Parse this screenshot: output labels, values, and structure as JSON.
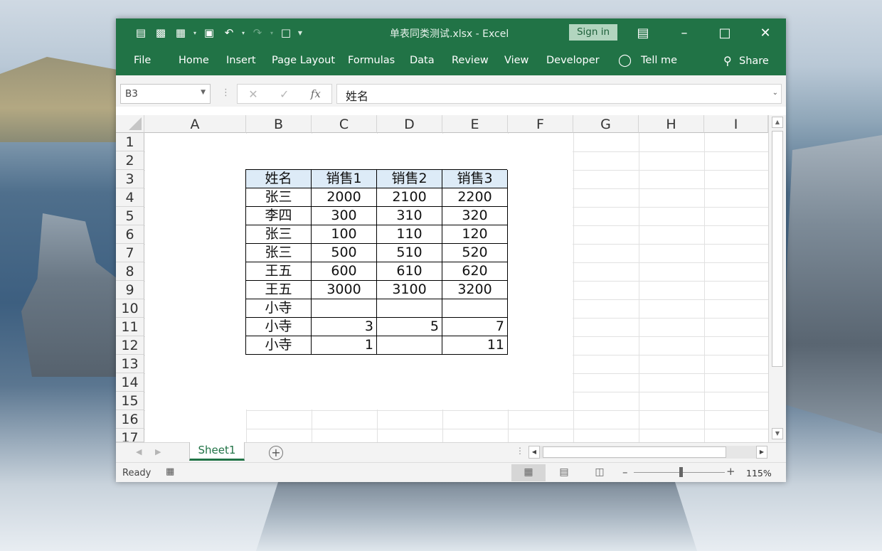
{
  "window": {
    "title": "单表同类测试.xlsx  -  Excel",
    "signin_label": "Sign in",
    "accent_color": "#217346"
  },
  "quick_access": {
    "icons": [
      "form-icon",
      "save-as-icon",
      "layout-icon",
      "save-icon",
      "undo-icon",
      "redo-icon",
      "new-doc-icon",
      "customize-icon"
    ]
  },
  "ribbon": {
    "tabs": [
      "File",
      "Home",
      "Insert",
      "Page Layout",
      "Formulas",
      "Data",
      "Review",
      "View",
      "Developer"
    ],
    "tell_me": "Tell me",
    "share": "Share"
  },
  "formula_bar": {
    "name_box": "B3",
    "content": "姓名",
    "fx_label": "fx"
  },
  "grid": {
    "columns": [
      "A",
      "B",
      "C",
      "D",
      "E",
      "F",
      "G",
      "H",
      "I"
    ],
    "rows": [
      "1",
      "2",
      "3",
      "4",
      "5",
      "6",
      "7",
      "8",
      "9",
      "10",
      "11",
      "12",
      "13",
      "14",
      "15",
      "16",
      "17"
    ]
  },
  "table": {
    "headers": [
      "姓名",
      "销售1",
      "销售2",
      "销售3"
    ],
    "header_fill": "#ddebf7",
    "rows": [
      [
        "张三",
        "2000",
        "2100",
        "2200"
      ],
      [
        "李四",
        "300",
        "310",
        "320"
      ],
      [
        "张三",
        "100",
        "110",
        "120"
      ],
      [
        "张三",
        "500",
        "510",
        "520"
      ],
      [
        "王五",
        "600",
        "610",
        "620"
      ],
      [
        "王五",
        "3000",
        "3100",
        "3200"
      ],
      [
        "小寺",
        "",
        "",
        ""
      ],
      [
        "小寺",
        "3",
        "5",
        "7"
      ],
      [
        "小寺",
        "1",
        "",
        "11"
      ]
    ]
  },
  "sheets": {
    "active": "Sheet1"
  },
  "status": {
    "ready": "Ready",
    "zoom": "115%"
  }
}
